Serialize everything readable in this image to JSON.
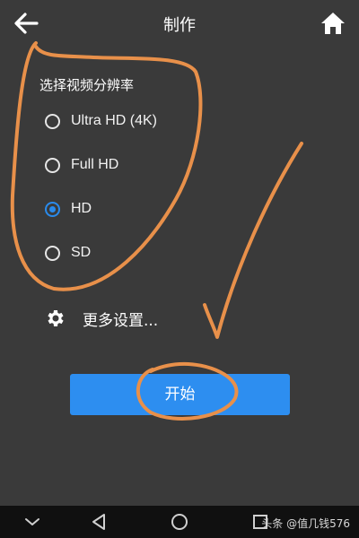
{
  "header": {
    "title": "制作",
    "back_icon": "arrow-left-icon",
    "home_icon": "home-icon"
  },
  "resolution": {
    "title": "选择视频分辨率",
    "options": [
      {
        "label": "Ultra HD (4K)",
        "selected": false
      },
      {
        "label": "Full HD",
        "selected": false
      },
      {
        "label": "HD",
        "selected": true
      },
      {
        "label": "SD",
        "selected": false
      }
    ]
  },
  "more_settings": {
    "label": "更多设置...",
    "icon": "gear-icon"
  },
  "start_button": {
    "label": "开始"
  },
  "system_nav": {
    "icons": [
      "chevron-down-icon",
      "back-triangle-icon",
      "home-circle-icon",
      "recents-square-icon"
    ]
  },
  "watermark": {
    "text": "头条 @值几钱576"
  },
  "colors": {
    "background": "#3a3a3a",
    "accent": "#2d8ef0",
    "annotation": "#e8904a"
  }
}
